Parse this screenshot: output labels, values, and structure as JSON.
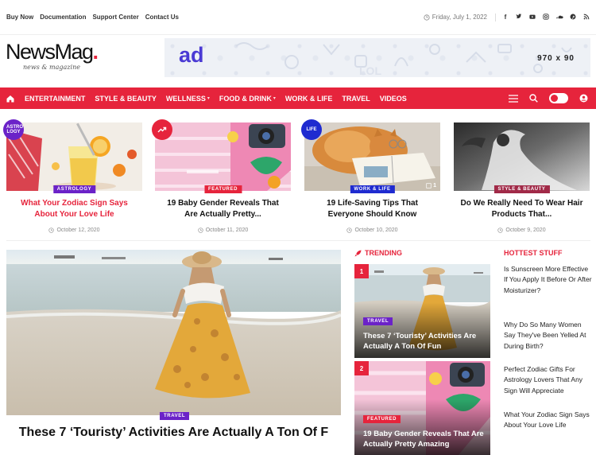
{
  "topbar": {
    "links": [
      "Buy Now",
      "Documentation",
      "Support Center",
      "Contact Us"
    ],
    "date": "Friday, July 1, 2022",
    "social_icons": [
      "facebook-icon",
      "twitter-icon",
      "youtube-icon",
      "instagram-icon",
      "soundcloud-icon",
      "pinterest-icon",
      "rss-icon"
    ]
  },
  "header": {
    "logo_main": "NewsMag",
    "logo_sub": "news & magazine",
    "ad_text": "ad",
    "ad_size": "970 x 90"
  },
  "nav": {
    "items": [
      {
        "label": "ENTERTAINMENT",
        "dropdown": false
      },
      {
        "label": "STYLE & BEAUTY",
        "dropdown": false
      },
      {
        "label": "WELLNESS",
        "dropdown": true
      },
      {
        "label": "FOOD & DRINK",
        "dropdown": true
      },
      {
        "label": "WORK & LIFE",
        "dropdown": false
      },
      {
        "label": "TRAVEL",
        "dropdown": false
      },
      {
        "label": "VIDEOS",
        "dropdown": false
      }
    ]
  },
  "cards": [
    {
      "badge": "ASTRO LOGY",
      "badge_color": "#6b22c8",
      "tag": "ASTROLOGY",
      "tag_color": "#6b22c8",
      "title": "What Your Zodiac Sign Says About Your Love Life",
      "title_color": "#e6243c",
      "date": "October 12, 2020"
    },
    {
      "badge": "trending",
      "badge_color": "#e6243c",
      "tag": "FEATURED",
      "tag_color": "#e6243c",
      "title": "19 Baby Gender Reveals That Are Actually Pretty...",
      "title_color": "#111111",
      "date": "October 11, 2020"
    },
    {
      "badge": "LIFE",
      "badge_color": "#1f2bd0",
      "tag": "WORK & LIFE",
      "tag_color": "#1f2bd0",
      "title": "19 Life-Saving Tips That Everyone Should Know",
      "title_color": "#111111",
      "date": "October 10, 2020",
      "gallery": "1"
    },
    {
      "badge": "",
      "badge_color": "",
      "tag": "STYLE & BEAUTY",
      "tag_color": "#a12a48",
      "title": "Do We Really Need To Wear Hair Products That...",
      "title_color": "#111111",
      "date": "October 9, 2020"
    }
  ],
  "feature": {
    "tag": "TRAVEL",
    "title": "These 7 ‘Touristy’ Activities Are Actually A Ton Of F"
  },
  "trending": {
    "heading": "TRENDING",
    "items": [
      {
        "num": "1",
        "tag": "TRAVEL",
        "tag_color": "#6b22c8",
        "title": "These 7 ‘Touristy’ Activities Are Actually A Ton Of Fun"
      },
      {
        "num": "2",
        "tag": "FEATURED",
        "tag_color": "#e6243c",
        "title": "19 Baby Gender Reveals That Are Actually Pretty Amazing"
      }
    ]
  },
  "hottest": {
    "heading": "HOTTEST STUFF",
    "items": [
      "Is Sunscreen More Effective If You Apply It Before Or After Moisturizer?",
      "Why Do So Many Women Say They've Been Yelled At During Birth?",
      "Perfect Zodiac Gifts For Astrology Lovers That Any Sign Will Appreciate",
      "What Your Zodiac Sign Says About Your Love Life"
    ]
  }
}
